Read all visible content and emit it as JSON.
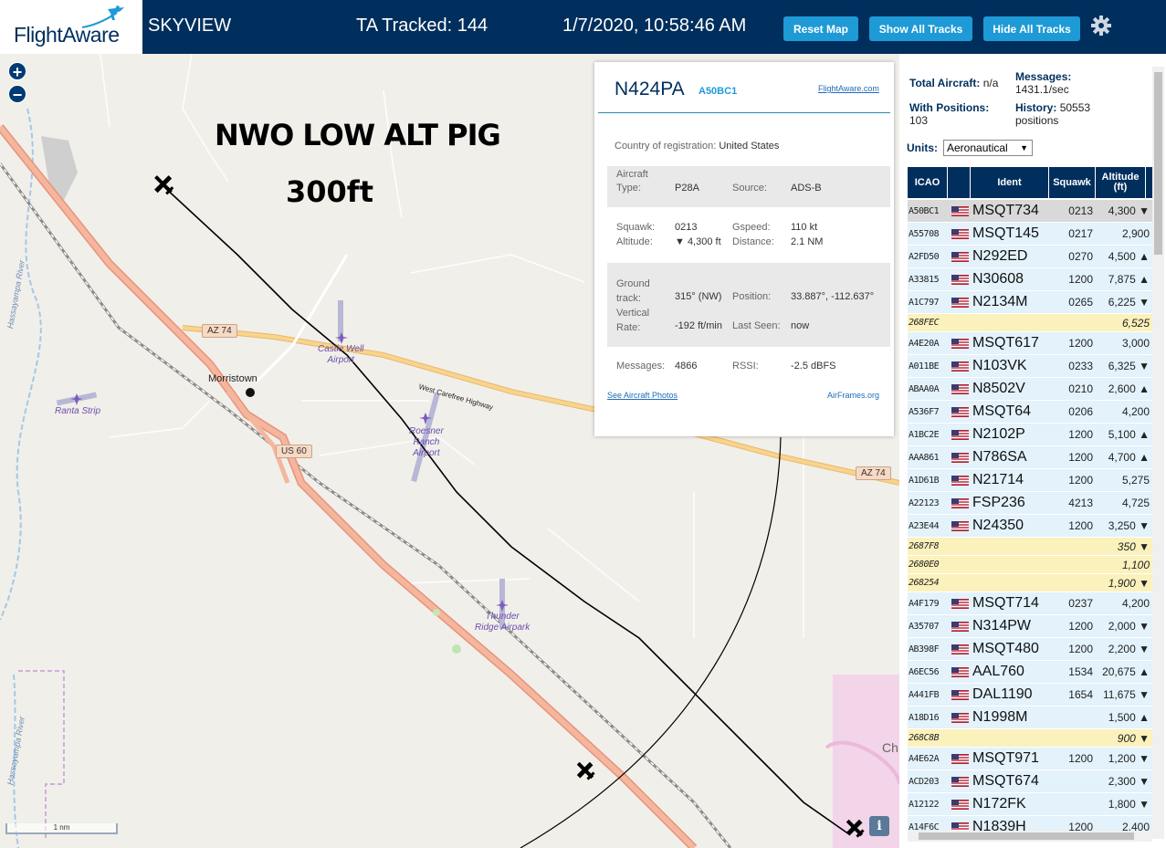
{
  "header": {
    "logo_text": "FlightAware",
    "site_name": "SKYVIEW",
    "tracked": "TA Tracked: 144",
    "datetime": "1/7/2020, 10:58:46 AM",
    "buttons": {
      "reset": "Reset Map",
      "show": "Show All Tracks",
      "hide": "Hide All Tracks"
    },
    "colors": {
      "bar": "#002f5d",
      "button": "#1e9ad6"
    }
  },
  "map": {
    "annotation_line1": "NWO LOW ALT PIG",
    "annotation_line2": "300ft",
    "zoom_in": "+",
    "zoom_out": "−",
    "places": {
      "morristown": "Morristown",
      "highway": "West Carefree Highway",
      "ch": "Ch"
    },
    "shields": {
      "az74a": "AZ 74",
      "az74b": "AZ 74",
      "us60": "US 60"
    },
    "airports": {
      "castle_well": "Castle Well\nAirport",
      "ranta": "Ranta Strip",
      "roesner": "Roesner\nRanch\nAirport",
      "thunder": "Thunder\nRidge Airpark"
    },
    "rivers": {
      "r1": "Hassayampa River",
      "r2": "Hassayampa River"
    },
    "scale": "1 nm",
    "info": "i"
  },
  "popup": {
    "callsign": "N424PA",
    "hex": "A50BC1",
    "link_fa": "FlightAware.com",
    "country_label": "Country of registration:",
    "country": "United States",
    "type_label": "Aircraft\nType:",
    "type": "P28A",
    "source_label": "Source:",
    "source": "ADS-B",
    "squawk_label": "Squawk:",
    "squawk": "0213",
    "altitude_label": "Altitude:",
    "altitude": "▼ 4,300 ft",
    "gspeed_label": "Gspeed:",
    "gspeed": "110 kt",
    "distance_label": "Distance:",
    "distance": "2.1 NM",
    "track_label": "Ground\ntrack:",
    "track": "315° (NW)",
    "vrate_label": "Vertical\nRate:",
    "vrate": "-192 ft/min",
    "position_label": "Position:",
    "position": "33.887°, -112.637°",
    "lastseen_label": "Last Seen:",
    "lastseen": "now",
    "messages_label": "Messages:",
    "messages": "4866",
    "rssi_label": "RSSI:",
    "rssi": "-2.5 dBFS",
    "link_photos": "See Aircraft Photos",
    "link_airframes": "AirFrames.org"
  },
  "sidebar": {
    "total_label": "Total Aircraft:",
    "total": "n/a",
    "messages_label": "Messages:",
    "messages": "1431.1/sec",
    "withpos_label": "With Positions:",
    "withpos": "103",
    "history_label": "History:",
    "history": "50553\npositions",
    "units_label": "Units:",
    "units_value": "Aeronautical",
    "columns": {
      "icao": "ICAO",
      "ident": "Ident",
      "squawk": "Squawk",
      "altitude": "Altitude\n(ft)"
    },
    "rows": [
      {
        "icao": "A50BC1",
        "flag": true,
        "ident": "MSQT734",
        "squawk": "0213",
        "alt": "4,300 ▼",
        "kind": "sel"
      },
      {
        "icao": "A55708",
        "flag": true,
        "ident": "MSQT145",
        "squawk": "0217",
        "alt": "2,900",
        "kind": ""
      },
      {
        "icao": "A2FD50",
        "flag": true,
        "ident": "N292ED",
        "squawk": "0270",
        "alt": "4,500 ▲",
        "kind": ""
      },
      {
        "icao": "A33815",
        "flag": true,
        "ident": "N30608",
        "squawk": "1200",
        "alt": "7,875 ▲",
        "kind": ""
      },
      {
        "icao": "A1C797",
        "flag": true,
        "ident": "N2134M",
        "squawk": "0265",
        "alt": "6,225 ▼",
        "kind": ""
      },
      {
        "icao": "268FEC",
        "flag": false,
        "ident": "",
        "squawk": "",
        "alt": "6,525",
        "kind": "yel"
      },
      {
        "icao": "A4E20A",
        "flag": true,
        "ident": "MSQT617",
        "squawk": "1200",
        "alt": "3,000",
        "kind": ""
      },
      {
        "icao": "A011BE",
        "flag": true,
        "ident": "N103VK",
        "squawk": "0233",
        "alt": "6,325 ▼",
        "kind": ""
      },
      {
        "icao": "ABAA0A",
        "flag": true,
        "ident": "N8502V",
        "squawk": "0210",
        "alt": "2,600 ▲",
        "kind": ""
      },
      {
        "icao": "A536F7",
        "flag": true,
        "ident": "MSQT64",
        "squawk": "0206",
        "alt": "4,200",
        "kind": ""
      },
      {
        "icao": "A1BC2E",
        "flag": true,
        "ident": "N2102P",
        "squawk": "1200",
        "alt": "5,100 ▲",
        "kind": ""
      },
      {
        "icao": "AAA861",
        "flag": true,
        "ident": "N786SA",
        "squawk": "1200",
        "alt": "4,700 ▲",
        "kind": ""
      },
      {
        "icao": "A1D61B",
        "flag": true,
        "ident": "N21714",
        "squawk": "1200",
        "alt": "5,275",
        "kind": ""
      },
      {
        "icao": "A22123",
        "flag": true,
        "ident": "FSP236",
        "squawk": "4213",
        "alt": "4,725",
        "kind": ""
      },
      {
        "icao": "A23E44",
        "flag": true,
        "ident": "N24350",
        "squawk": "1200",
        "alt": "3,250 ▼",
        "kind": ""
      },
      {
        "icao": "2687F8",
        "flag": false,
        "ident": "",
        "squawk": "",
        "alt": "350 ▼",
        "kind": "yel"
      },
      {
        "icao": "2680E0",
        "flag": false,
        "ident": "",
        "squawk": "",
        "alt": "1,100",
        "kind": "yel"
      },
      {
        "icao": "268254",
        "flag": false,
        "ident": "",
        "squawk": "",
        "alt": "1,900 ▼",
        "kind": "yel"
      },
      {
        "icao": "A4F179",
        "flag": true,
        "ident": "MSQT714",
        "squawk": "0237",
        "alt": "4,200",
        "kind": ""
      },
      {
        "icao": "A35707",
        "flag": true,
        "ident": "N314PW",
        "squawk": "1200",
        "alt": "2,000 ▼",
        "kind": ""
      },
      {
        "icao": "AB398F",
        "flag": true,
        "ident": "MSQT480",
        "squawk": "1200",
        "alt": "2,200 ▼",
        "kind": ""
      },
      {
        "icao": "A6EC56",
        "flag": true,
        "ident": "AAL760",
        "squawk": "1534",
        "alt": "20,675 ▲",
        "kind": ""
      },
      {
        "icao": "A441FB",
        "flag": true,
        "ident": "DAL1190",
        "squawk": "1654",
        "alt": "11,675 ▼",
        "kind": ""
      },
      {
        "icao": "A18D16",
        "flag": true,
        "ident": "N1998M",
        "squawk": "",
        "alt": "1,500 ▲",
        "kind": ""
      },
      {
        "icao": "268C8B",
        "flag": false,
        "ident": "",
        "squawk": "",
        "alt": "900 ▼",
        "kind": "yel"
      },
      {
        "icao": "A4E62A",
        "flag": true,
        "ident": "MSQT971",
        "squawk": "1200",
        "alt": "1,200 ▼",
        "kind": ""
      },
      {
        "icao": "ACD203",
        "flag": true,
        "ident": "MSQT674",
        "squawk": "",
        "alt": "2,300 ▼",
        "kind": ""
      },
      {
        "icao": "A12122",
        "flag": true,
        "ident": "N172FK",
        "squawk": "",
        "alt": "1,800 ▼",
        "kind": ""
      },
      {
        "icao": "A14F6C",
        "flag": true,
        "ident": "N1839H",
        "squawk": "1200",
        "alt": "2,400",
        "kind": ""
      }
    ]
  }
}
